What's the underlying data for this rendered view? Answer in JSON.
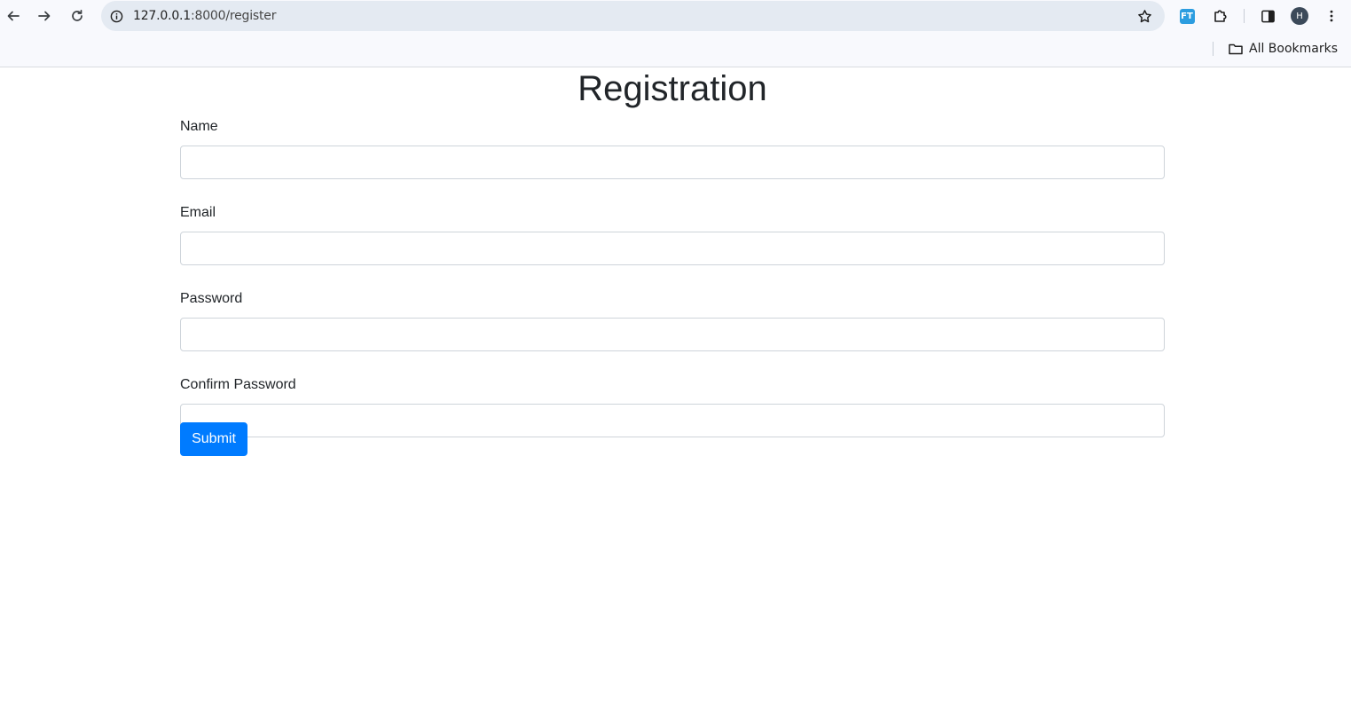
{
  "browser": {
    "url_host": "127.0.0.1",
    "url_path": ":8000/register",
    "bookmarks_label": "All Bookmarks",
    "profile_initial": "H",
    "extension_label": "FT"
  },
  "page": {
    "title": "Registration",
    "fields": [
      {
        "label": "Name",
        "value": ""
      },
      {
        "label": "Email",
        "value": ""
      },
      {
        "label": "Password",
        "value": ""
      },
      {
        "label": "Confirm Password",
        "value": ""
      }
    ],
    "submit_label": "Submit"
  },
  "colors": {
    "primary_button": "#007bff",
    "text": "#212529",
    "input_border": "#ced4da"
  }
}
